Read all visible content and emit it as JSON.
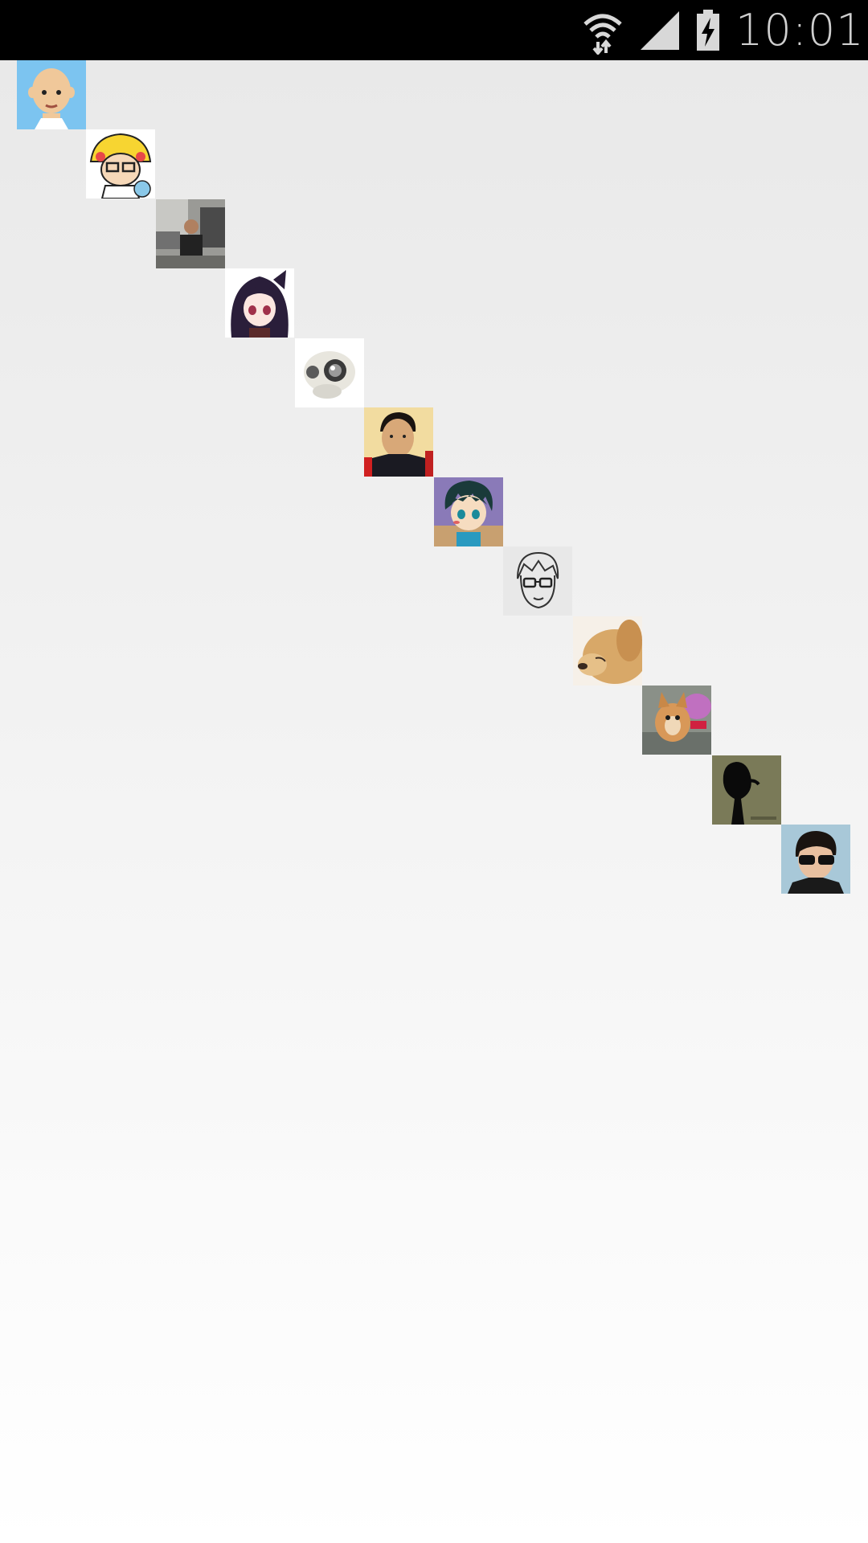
{
  "status_bar": {
    "time": "10:01",
    "icons": [
      "wifi-icon",
      "cell-signal-icon",
      "battery-charging-icon"
    ],
    "background": "#000000"
  },
  "avatars": [
    {
      "name": "bald-cartoon-avatar",
      "bg": "#7cc4f0"
    },
    {
      "name": "pikachu-hat-cartoon-avatar",
      "bg": "#ffffff"
    },
    {
      "name": "street-photo-avatar",
      "bg": "#8a8a88"
    },
    {
      "name": "anime-girl-avatar",
      "bg": "#ffffff"
    },
    {
      "name": "skull-avatar",
      "bg": "#ffffff"
    },
    {
      "name": "young-man-photo-avatar",
      "bg": "#f2dca0"
    },
    {
      "name": "anime-boy-avatar",
      "bg": "#8a7ab8"
    },
    {
      "name": "sketch-glasses-avatar",
      "bg": "#e8e8e8"
    },
    {
      "name": "golden-dog-avatar",
      "bg": "#d8b07a"
    },
    {
      "name": "small-dog-avatar",
      "bg": "#8a9088"
    },
    {
      "name": "silhouette-avatar",
      "bg": "#7a7a58"
    },
    {
      "name": "sunglasses-man-avatar",
      "bg": "#a8c8d8"
    }
  ]
}
